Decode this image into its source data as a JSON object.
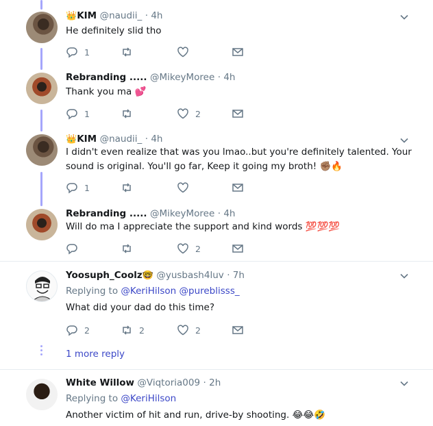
{
  "colors": {
    "accent": "#3b47c7",
    "muted": "#657786",
    "thread": "#a5a6fb",
    "divider": "#e6ecf0"
  },
  "tweets": [
    {
      "name": "KIM",
      "name_emoji": "👑",
      "handle": "@naudii_",
      "time": "· 4h",
      "text": "He definitely slid tho",
      "reply_count": "1",
      "retweet_count": "",
      "like_count": ""
    },
    {
      "name": "Rebranding .....",
      "handle": "@MikeyMoree",
      "time": "· 4h",
      "text": "Thank you ma 💕",
      "reply_count": "1",
      "retweet_count": "",
      "like_count": "2"
    },
    {
      "name": "KIM",
      "name_emoji": "👑",
      "handle": "@naudii_",
      "time": "· 4h",
      "text": "I didn't even realize that was you lmao..but you're definitely talented. Your sound is original. You'll go far, Keep it going my broth! ✊🏽🔥",
      "reply_count": "1",
      "retweet_count": "",
      "like_count": ""
    },
    {
      "name": "Rebranding .....",
      "handle": "@MikeyMoree",
      "time": "· 4h",
      "text": "Will do ma I appreciate the support and kind words 💯💯💯",
      "reply_count": "",
      "retweet_count": "",
      "like_count": "2"
    },
    {
      "name": "Yoosuph_Coolz",
      "name_emoji": "🤓",
      "handle": "@yusbash4luv",
      "time": "· 7h",
      "replying_label": "Replying to",
      "replying_to_1": "@KeriHilson",
      "replying_to_2": "@pureblisss_",
      "text": "What did your dad do this time?",
      "reply_count": "2",
      "retweet_count": "2",
      "like_count": "2",
      "more_replies": "1 more reply"
    },
    {
      "name": "White Willow",
      "handle": "@Viqtoria009",
      "time": "· 2h",
      "replying_label": "Replying to",
      "replying_to_1": "@KeriHilson",
      "text": "Another victim of hit and run, drive-by shooting. 😂😂🤣"
    }
  ]
}
